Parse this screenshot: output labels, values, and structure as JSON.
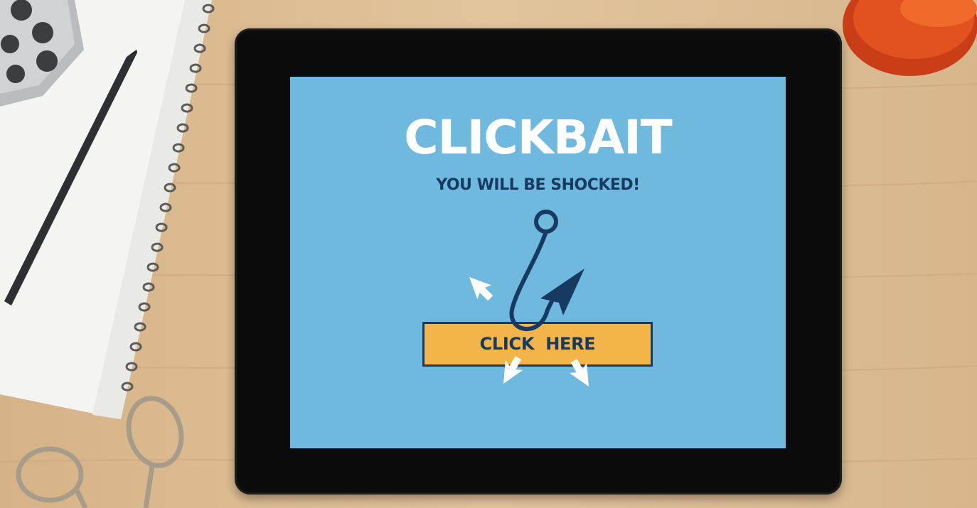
{
  "screen": {
    "headline": "CLICKBAIT",
    "subheadline": "YOU WILL BE SHOCKED!",
    "button_label": "CLICK  HERE"
  },
  "colors": {
    "desk": "#d9b98f",
    "tablet_bezel": "#0b0b0b",
    "screen_background": "#6fb9df",
    "headline_text": "#ffffff",
    "accent_navy": "#173a62",
    "button_fill": "#f3b44a",
    "cup": "#d9481f"
  },
  "icons": {
    "hook": "fishing-hook-icon",
    "cursor": "arrow-cursor-icon"
  }
}
